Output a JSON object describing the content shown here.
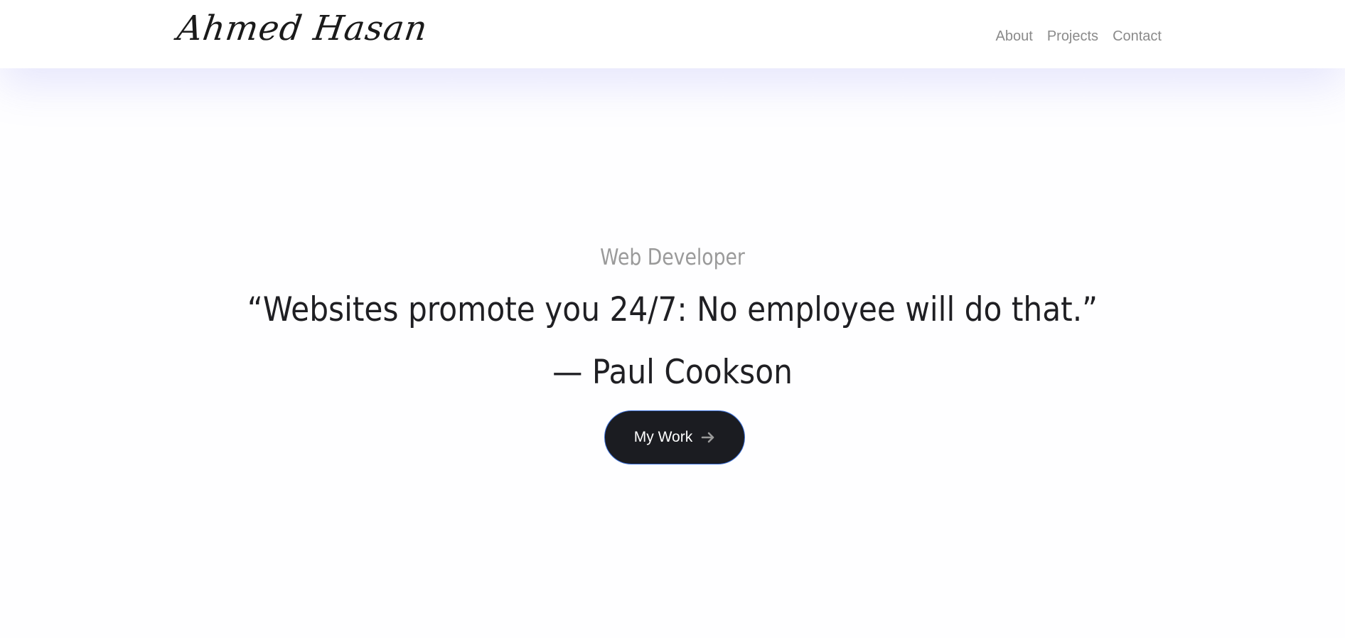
{
  "header": {
    "brand": "Ahmed Hasan",
    "nav": [
      {
        "label": "About"
      },
      {
        "label": "Projects"
      },
      {
        "label": "Contact"
      }
    ]
  },
  "hero": {
    "subtitle": "Web Developer",
    "quote": "“Websites promote you 24/7: No employee will do that.”",
    "author": "— Paul Cookson",
    "cta_label": "My Work",
    "cta_icon": "arrow-right-icon"
  },
  "colors": {
    "button_bg": "#1b1c21",
    "button_border": "#3b6fd8",
    "nav_text": "#8a8a8a",
    "subtitle_text": "#9a9a9a",
    "quote_text": "#1f1f23"
  }
}
